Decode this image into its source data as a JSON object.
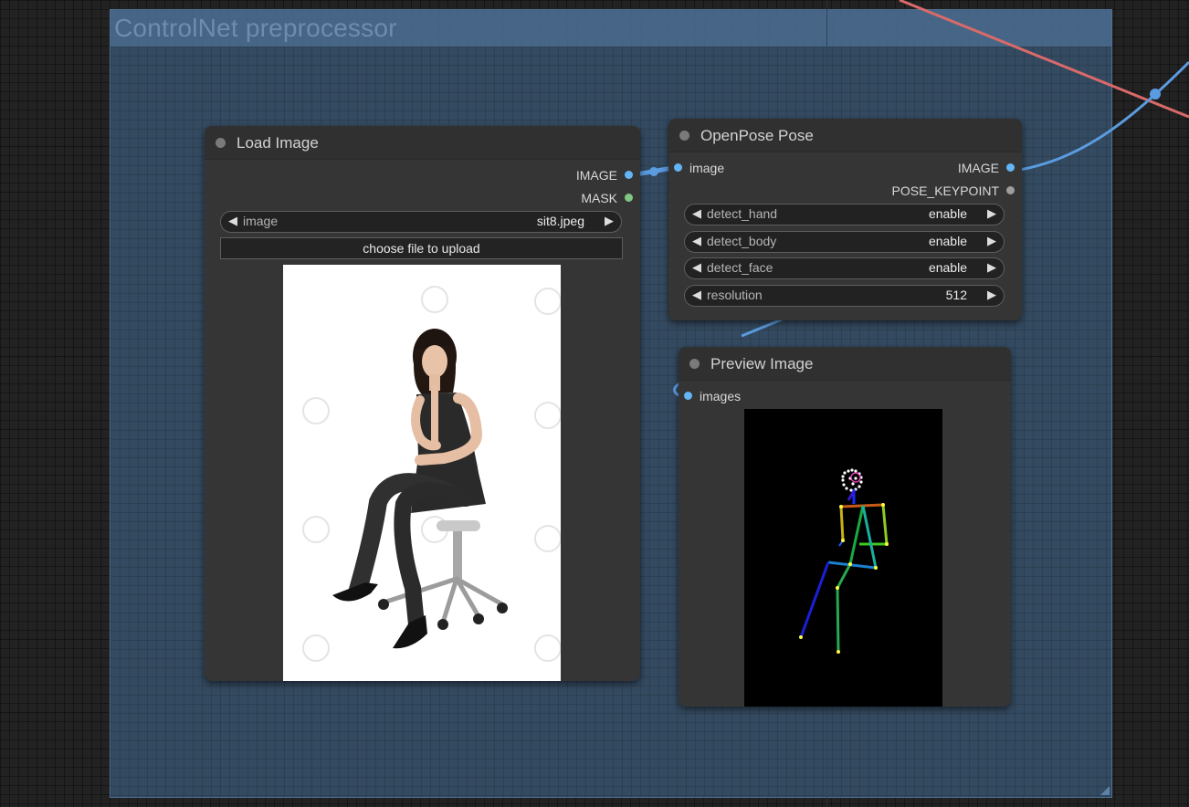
{
  "group": {
    "title": "ControlNet preprocessor"
  },
  "load_image": {
    "title": "Load Image",
    "outputs": [
      {
        "label": "IMAGE",
        "color": "#64b5f6"
      },
      {
        "label": "MASK",
        "color": "#81c784"
      }
    ],
    "image_widget": {
      "name": "image",
      "value": "sit8.jpeg"
    },
    "upload_button": "choose file to upload",
    "preview": {
      "description_icon": "photo-woman-sitting-on-office-chair"
    }
  },
  "openpose": {
    "title": "OpenPose Pose",
    "input": {
      "label": "image",
      "color": "#64b5f6"
    },
    "outputs": [
      {
        "label": "IMAGE",
        "color": "#64b5f6"
      },
      {
        "label": "POSE_KEYPOINT",
        "color": "#9e9e9e"
      }
    ],
    "widgets": [
      {
        "name": "detect_hand",
        "value": "enable"
      },
      {
        "name": "detect_body",
        "value": "enable"
      },
      {
        "name": "detect_face",
        "value": "enable"
      },
      {
        "name": "resolution",
        "value": "512"
      }
    ]
  },
  "preview_image": {
    "title": "Preview Image",
    "input": {
      "label": "images",
      "color": "#64b5f6"
    }
  },
  "arrows": {
    "left": "◀",
    "right": "▶"
  },
  "colors": {
    "image_link": "#64a6e6",
    "red_link": "#e06666",
    "group_fill": "#364e66"
  }
}
